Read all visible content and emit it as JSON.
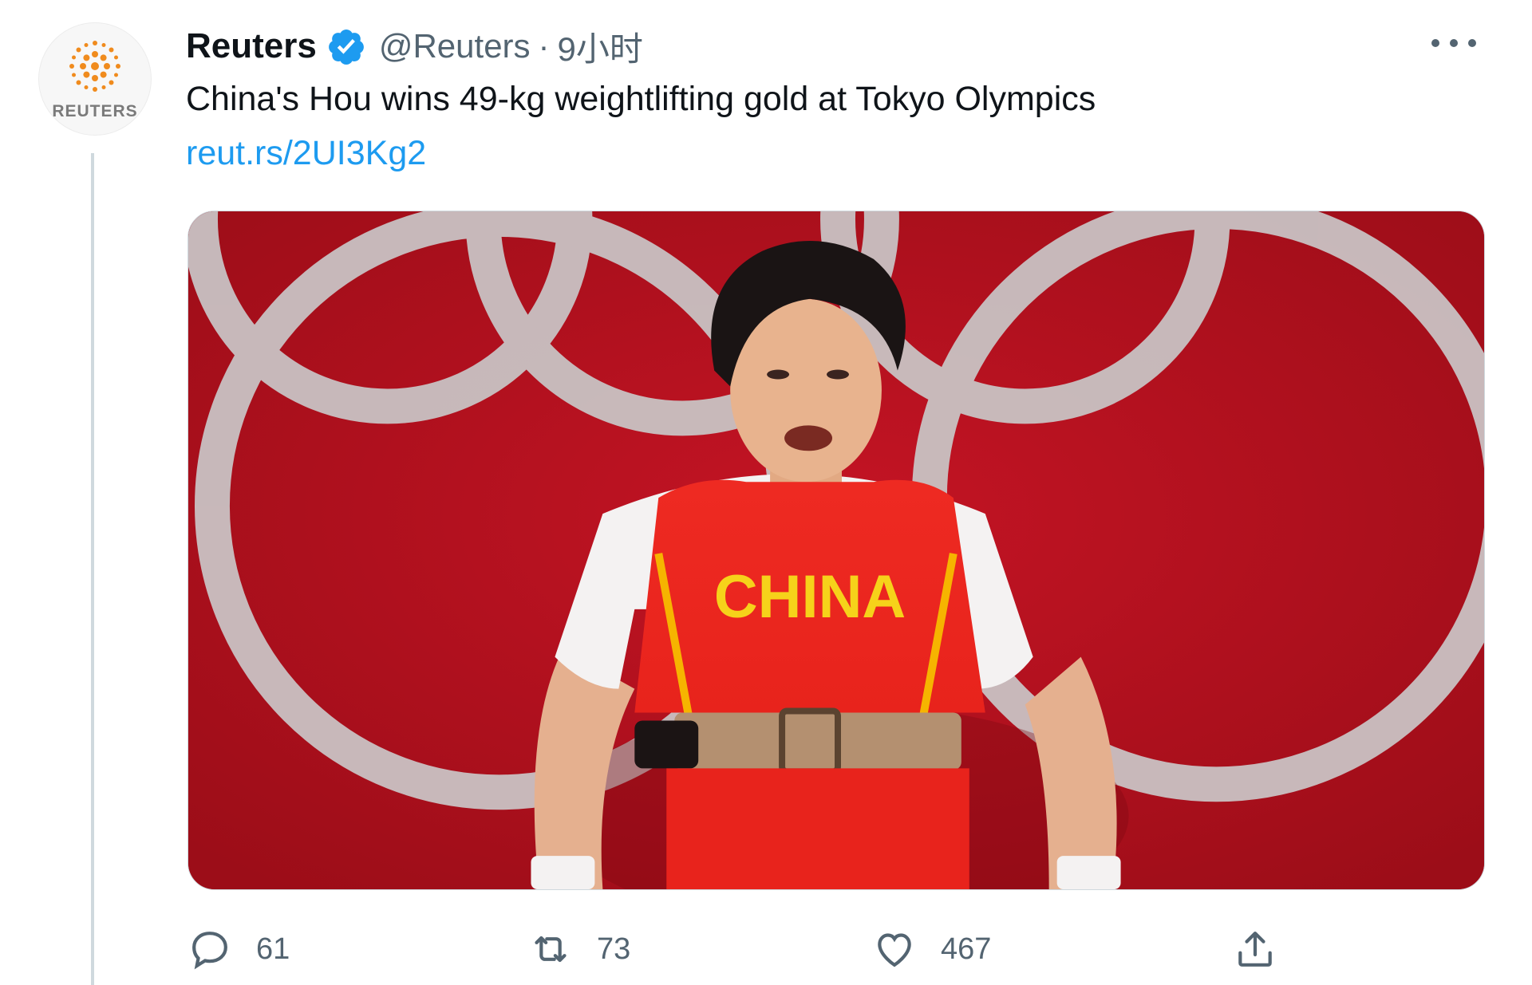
{
  "account": {
    "avatar_text": "REUTERS",
    "name": "Reuters",
    "handle": "@Reuters",
    "separator": "·",
    "time": "9小时"
  },
  "tweet": {
    "text": "China's Hou wins 49-kg weightlifting gold at Tokyo Olympics",
    "link": "reut.rs/2UI3Kg2"
  },
  "media": {
    "jersey_text": "CHINA"
  },
  "actions": {
    "reply_count": "61",
    "retweet_count": "73",
    "like_count": "467"
  },
  "colors": {
    "link": "#1d9bf0",
    "verified": "#1d9bf0",
    "muted_text": "#536471",
    "background_red": "#b3101e"
  },
  "icons": {
    "avatar": "reuters-logo",
    "verified": "verified-badge-icon",
    "more": "more-options-icon",
    "reply": "reply-icon",
    "retweet": "retweet-icon",
    "like": "heart-icon",
    "share": "share-icon"
  }
}
